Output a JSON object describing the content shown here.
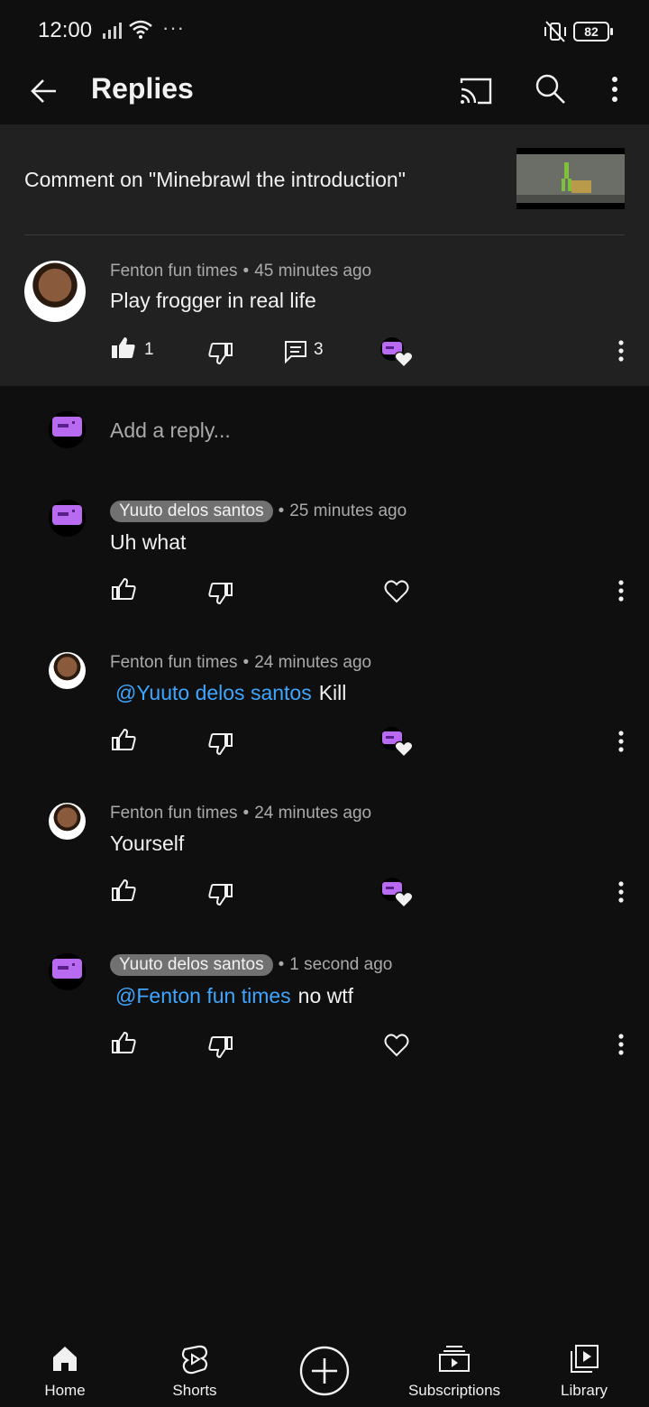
{
  "status_bar": {
    "time": "12:00",
    "battery": "82"
  },
  "app_bar": {
    "title": "Replies"
  },
  "video": {
    "title": "Comment on \"Minebrawl the introduction\""
  },
  "top_comment": {
    "author": "Fenton fun times",
    "time": "45 minutes ago",
    "text": "Play frogger in real life",
    "likes": "1",
    "replies": "3"
  },
  "reply_box": {
    "placeholder": "Add a reply..."
  },
  "replies": [
    {
      "author": "Yuuto delos santos",
      "time": "25 minutes ago",
      "mention": "",
      "text": "Uh what"
    },
    {
      "author": "Fenton fun times",
      "time": "24 minutes ago",
      "mention": "@Yuuto delos santos",
      "text": "Kill"
    },
    {
      "author": "Fenton fun times",
      "time": "24 minutes ago",
      "mention": "",
      "text": "Yourself"
    },
    {
      "author": "Yuuto delos santos",
      "time": "1 second ago",
      "mention": "@Fenton fun times",
      "text": "no wtf"
    }
  ],
  "nav": {
    "home": "Home",
    "shorts": "Shorts",
    "subscriptions": "Subscriptions",
    "library": "Library"
  },
  "icons": [
    "arrow-left-icon",
    "cast-icon",
    "search-icon",
    "more-vert-icon",
    "thumb-up-icon",
    "thumb-down-icon",
    "comment-icon",
    "heart-icon",
    "home-icon",
    "shorts-icon",
    "add-circle-icon",
    "subscriptions-icon",
    "library-icon"
  ],
  "colors": {
    "background": "#0f0f0f",
    "panel": "#212121",
    "mention": "#3ea6ff",
    "creator_chip": "#717171",
    "creator_avatar": "#b86bf0"
  }
}
